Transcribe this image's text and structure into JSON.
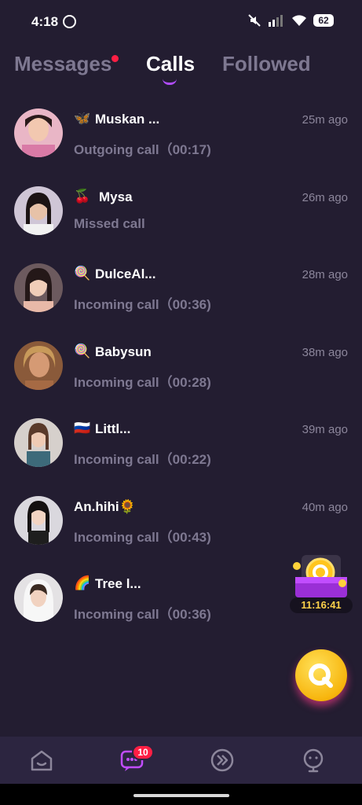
{
  "status_bar": {
    "time": "4:18",
    "battery": "62"
  },
  "tabs": [
    {
      "label": "Messages",
      "has_dot": true
    },
    {
      "label": "Calls",
      "active": true
    },
    {
      "label": "Followed"
    }
  ],
  "calls": [
    {
      "emoji": "🦋",
      "name": "Muskan ...",
      "time": "25m ago",
      "status": "Outgoing call（00:17)"
    },
    {
      "emoji": "🍒",
      "name": "Mysa",
      "time": "26m ago",
      "status": "Missed call"
    },
    {
      "emoji": "🍭",
      "name": "DulceAl...",
      "time": "28m ago",
      "status": "Incoming call（00:36)"
    },
    {
      "emoji": "🍭",
      "name": "Babysun",
      "time": "38m ago",
      "status": "Incoming call（00:28)"
    },
    {
      "emoji": "🇷🇺",
      "name": "Littl...",
      "time": "39m ago",
      "status": "Incoming call（00:22)"
    },
    {
      "emoji": "",
      "name": "An.hihi🌻",
      "time": "40m ago",
      "status": "Incoming call（00:43)"
    },
    {
      "emoji": "🌈",
      "name": "Tree l...",
      "time": "",
      "status": "Incoming call（00:36)"
    }
  ],
  "reward": {
    "timer": "11:16:41"
  },
  "bottom_nav": {
    "messages_badge": "10"
  },
  "colors": {
    "background": "#231d31",
    "accent": "#b04cff",
    "badge": "#ff1f44",
    "coin": "#f7b50d"
  }
}
